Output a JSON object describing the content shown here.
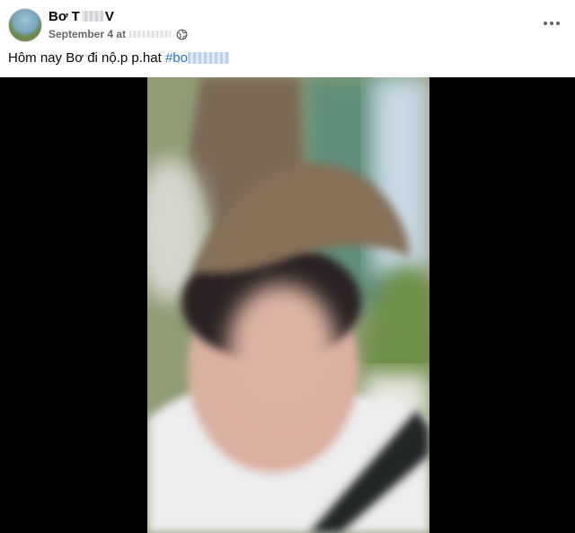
{
  "post": {
    "author_visible_start": "Bơ T",
    "author_visible_end": "V",
    "date_label": "September 4 at",
    "caption_text": "Hôm nay Bơ đi nộ.p p.hat ",
    "hashtag_visible": "#bo"
  },
  "icons": {
    "privacy": "globe-icon",
    "menu": "more-horizontal-icon"
  },
  "colors": {
    "link": "#216fdb",
    "meta": "#65676b",
    "letterbox": "#000000"
  }
}
